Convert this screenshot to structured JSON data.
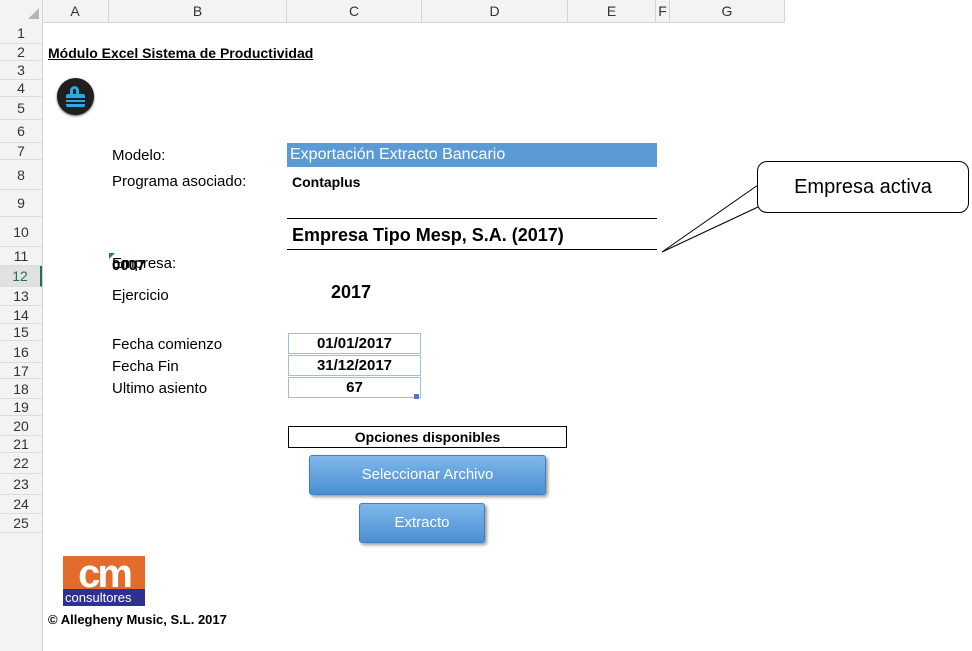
{
  "columns": [
    "A",
    "B",
    "C",
    "D",
    "E",
    "F",
    "G"
  ],
  "rows": [
    "1",
    "2",
    "3",
    "4",
    "5",
    "6",
    "7",
    "8",
    "9",
    "10",
    "11",
    "12",
    "13",
    "14",
    "15",
    "16",
    "17",
    "18",
    "19",
    "20",
    "21",
    "22",
    "23",
    "24",
    "25"
  ],
  "selected_row": "12",
  "sheet": {
    "title": "Módulo Excel Sistema de Productividad",
    "modelo_label": "Modelo:",
    "modelo_value": "Exportación Extracto Bancario",
    "programa_label": "Programa asociado:",
    "programa_value": "Contaplus",
    "empresa_label": "Empresa:",
    "empresa_value": "Empresa Tipo Mesp, S.A. (2017)",
    "empresa_code": "0007",
    "ejercicio_label": "Ejercicio",
    "ejercicio_value": "2017",
    "fecha_comienzo_label": "Fecha comienzo",
    "fecha_comienzo_value": "01/01/2017",
    "fecha_fin_label": "Fecha Fin",
    "fecha_fin_value": "31/12/2017",
    "ultimo_asiento_label": "Ultimo asiento",
    "ultimo_asiento_value": "67",
    "opciones_label": "Opciones disponibles",
    "btn_seleccionar": "Seleccionar Archivo",
    "btn_extracto": "Extracto",
    "callout": "Empresa activa",
    "logo_mark": "cm",
    "logo_text": "consultores",
    "copyright": "© Allegheny Music, S.L. 2017"
  },
  "icons": {
    "lock": "lock-icon",
    "logo": "cm-consultores-logo"
  },
  "colors": {
    "model_fill": "#5b9bd5",
    "button": "#5b9bd5",
    "logo_orange": "#e36c2c",
    "logo_blue": "#2e3192",
    "lock_blue": "#29a9e6"
  }
}
